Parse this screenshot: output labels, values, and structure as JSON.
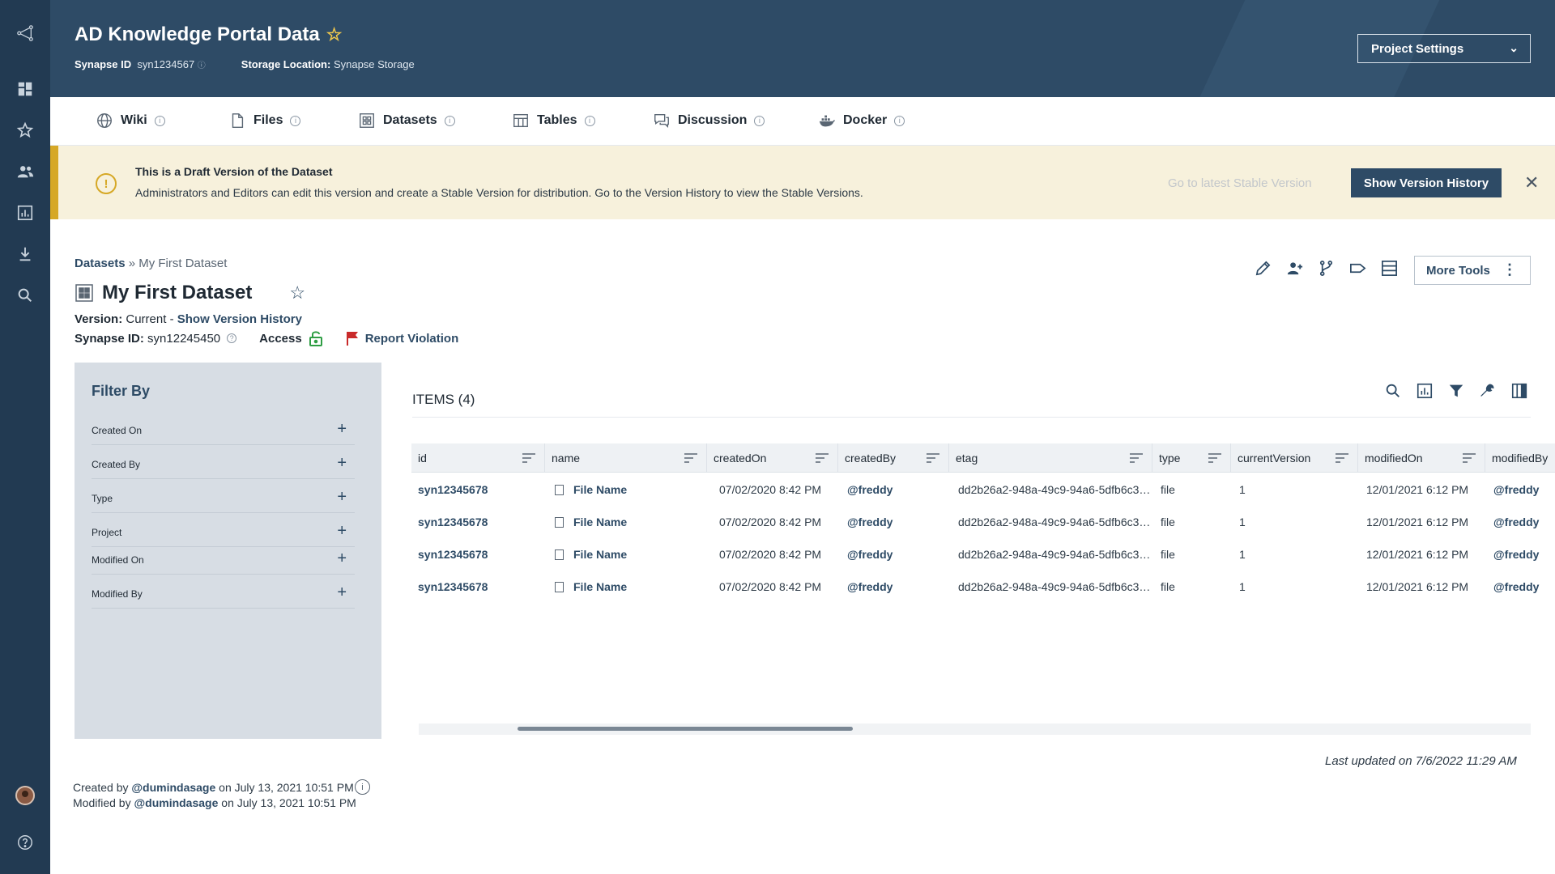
{
  "header": {
    "project_title": "AD Knowledge Portal Data",
    "synapse_id_label": "Synapse ID",
    "synapse_id": "syn1234567",
    "storage_label": "Storage Location:",
    "storage_value": "Synapse Storage",
    "project_settings_label": "Project Settings"
  },
  "tabs": [
    {
      "label": "Wiki",
      "icon": "globe-icon"
    },
    {
      "label": "Files",
      "icon": "file-icon"
    },
    {
      "label": "Datasets",
      "icon": "dataset-icon"
    },
    {
      "label": "Tables",
      "icon": "table-icon"
    },
    {
      "label": "Discussion",
      "icon": "discussion-icon"
    },
    {
      "label": "Docker",
      "icon": "docker-icon"
    }
  ],
  "banner": {
    "title": "This is a Draft Version of the Dataset",
    "text": "Administrators and Editors can edit this version and create a Stable Version for distribution. Go to the Version History to view the Stable Versions.",
    "latest_link": "Go to latest Stable Version",
    "show_history_button": "Show Version History"
  },
  "dataset": {
    "breadcrumb_root": "Datasets",
    "breadcrumb_sep": "»",
    "breadcrumb_current": "My First Dataset",
    "title": "My First Dataset",
    "version_label": "Version:",
    "version_value": "Current",
    "version_sep": "-",
    "version_link": "Show Version History",
    "synapse_id_label": "Synapse ID:",
    "synapse_id": "syn12245450",
    "access_label": "Access",
    "report_label": "Report Violation",
    "more_tools_label": "More Tools"
  },
  "filter": {
    "title": "Filter By",
    "items": [
      "Created On",
      "Created By",
      "Type",
      "Project",
      "Modified On",
      "Modified By"
    ]
  },
  "items": {
    "title": "ITEMS (4)",
    "columns": [
      "id",
      "name",
      "createdOn",
      "createdBy",
      "etag",
      "type",
      "currentVersion",
      "modifiedOn",
      "modifiedBy"
    ],
    "rows": [
      {
        "id": "syn12345678",
        "name": "File Name",
        "createdOn": "07/02/2020 8:42 PM",
        "createdBy": "@freddy",
        "etag": "dd2b26a2-948a-49c9-94a6-5dfb6c3…",
        "type": "file",
        "currentVersion": "1",
        "modifiedOn": "12/01/2021 6:12 PM",
        "modifiedBy": "@freddy"
      },
      {
        "id": "syn12345678",
        "name": "File Name",
        "createdOn": "07/02/2020 8:42 PM",
        "createdBy": "@freddy",
        "etag": "dd2b26a2-948a-49c9-94a6-5dfb6c3…",
        "type": "file",
        "currentVersion": "1",
        "modifiedOn": "12/01/2021 6:12 PM",
        "modifiedBy": "@freddy"
      },
      {
        "id": "syn12345678",
        "name": "File Name",
        "createdOn": "07/02/2020 8:42 PM",
        "createdBy": "@freddy",
        "etag": "dd2b26a2-948a-49c9-94a6-5dfb6c3…",
        "type": "file",
        "currentVersion": "1",
        "modifiedOn": "12/01/2021 6:12 PM",
        "modifiedBy": "@freddy"
      },
      {
        "id": "syn12345678",
        "name": "File Name",
        "createdOn": "07/02/2020 8:42 PM",
        "createdBy": "@freddy",
        "etag": "dd2b26a2-948a-49c9-94a6-5dfb6c3…",
        "type": "file",
        "currentVersion": "1",
        "modifiedOn": "12/01/2021 6:12 PM",
        "modifiedBy": "@freddy"
      }
    ],
    "last_updated": "Last updated on 7/6/2022 11:29 AM"
  },
  "footer": {
    "created_prefix": "Created by",
    "created_user": "@dumindasage",
    "created_suffix": "on July 13, 2021 10:51 PM",
    "modified_prefix": "Modified by",
    "modified_user": "@dumindasage",
    "modified_suffix": "on July 13, 2021 10:51 PM"
  },
  "colors": {
    "primary": "#2e4b66",
    "nav": "#223a52",
    "banner_bg": "#f7f1dc",
    "banner_accent": "#d6a826",
    "access_green": "#2f9e44",
    "report_red": "#c92a2a"
  }
}
